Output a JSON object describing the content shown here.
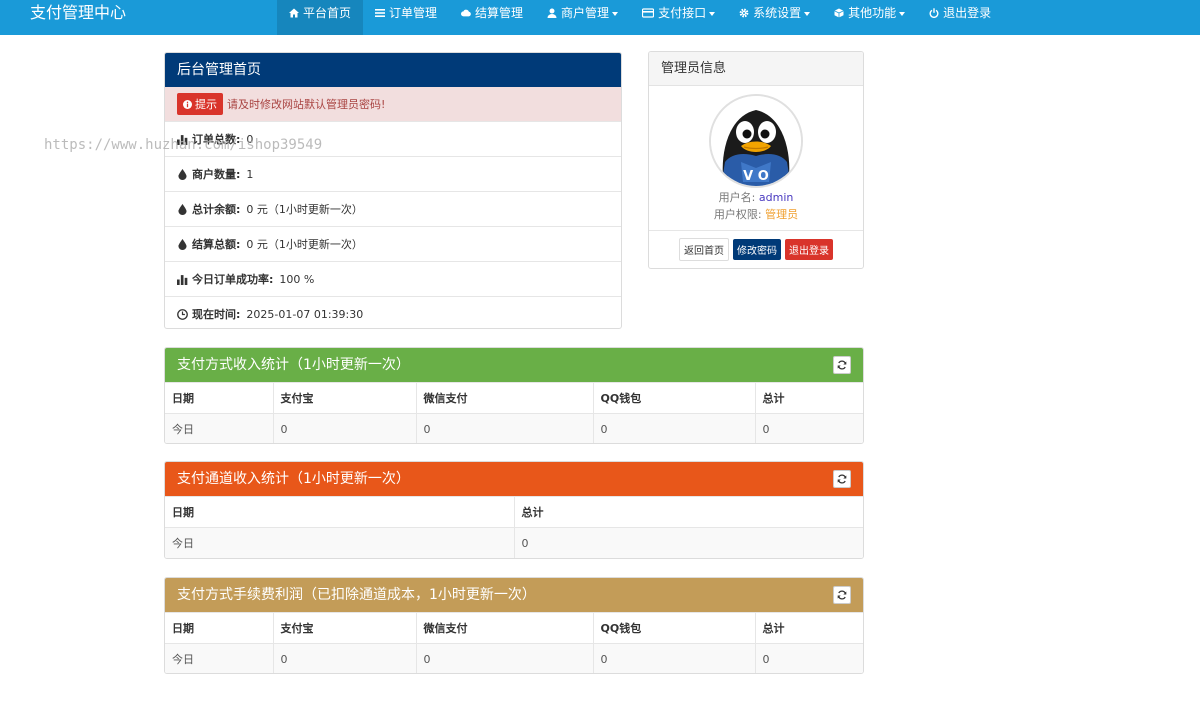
{
  "navbar": {
    "brand": "支付管理中心",
    "items": [
      {
        "label": "平台首页",
        "icon": "home-icon"
      },
      {
        "label": "订单管理",
        "icon": "list-icon"
      },
      {
        "label": "结算管理",
        "icon": "cloud-icon"
      },
      {
        "label": "商户管理",
        "icon": "user-icon"
      },
      {
        "label": "支付接口",
        "icon": "card-icon"
      },
      {
        "label": "系统设置",
        "icon": "gear-icon"
      },
      {
        "label": "其他功能",
        "icon": "cube-icon"
      },
      {
        "label": "退出登录",
        "icon": "power-icon"
      }
    ]
  },
  "overview": {
    "title": "后台管理首页",
    "alert_tag": "提示",
    "alert_text": "请及时修改网站默认管理员密码!",
    "rows": [
      {
        "label": "订单总数:",
        "value": "0",
        "icon": "bar-chart-icon"
      },
      {
        "label": "商户数量:",
        "value": "1",
        "icon": "drop-icon"
      },
      {
        "label": "总计余额:",
        "value": "0 元（1小时更新一次）",
        "icon": "drop-icon"
      },
      {
        "label": "结算总额:",
        "value": "0 元（1小时更新一次）",
        "icon": "drop-icon"
      },
      {
        "label": "今日订单成功率:",
        "value": "100 %",
        "icon": "bar-chart-icon"
      },
      {
        "label": "现在时间:",
        "value": "2025-01-07 01:39:30",
        "icon": "clock-icon"
      }
    ]
  },
  "watermark": "https://www.huzhan.com/ishop39549",
  "admin": {
    "title": "管理员信息",
    "username_label": "用户名:",
    "username": "admin",
    "role_label": "用户权限:",
    "role": "管理员",
    "btn_home": "返回首页",
    "btn_password": "修改密码",
    "btn_logout": "退出登录"
  },
  "pay_income": {
    "title": "支付方式收入统计（1小时更新一次）",
    "headers": [
      "日期",
      "支付宝",
      "微信支付",
      "QQ钱包",
      "总计"
    ],
    "row": [
      "今日",
      "0",
      "0",
      "0",
      "0"
    ]
  },
  "channel_income": {
    "title": "支付通道收入统计（1小时更新一次）",
    "headers": [
      "日期",
      "总计"
    ],
    "row": [
      "今日",
      "0"
    ]
  },
  "fee_profit": {
    "title": "支付方式手续费利润（已扣除通道成本，1小时更新一次）",
    "headers": [
      "日期",
      "支付宝",
      "微信支付",
      "QQ钱包",
      "总计"
    ],
    "row": [
      "今日",
      "0",
      "0",
      "0",
      "0"
    ]
  }
}
